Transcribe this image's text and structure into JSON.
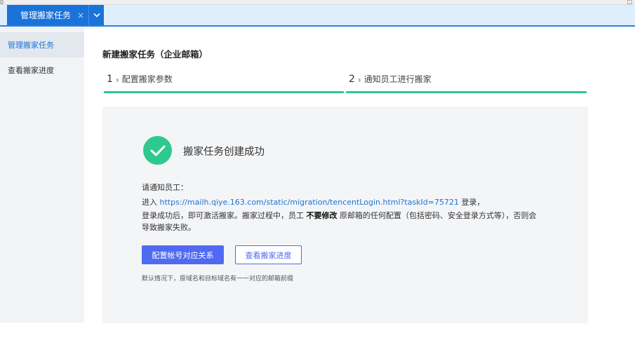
{
  "window": {
    "corner_left": "0",
    "corner_right": "□"
  },
  "tabs": [
    {
      "label": "管理搬家任务",
      "close": "×",
      "dropdown": "⌄"
    }
  ],
  "sidebar": {
    "items": [
      {
        "label": "管理搬家任务",
        "active": true
      },
      {
        "label": "查看搬家进度",
        "active": false
      }
    ]
  },
  "main": {
    "title": "新建搬家任务（企业邮箱）",
    "steps": [
      {
        "num": "1",
        "arrow": "›",
        "label": "配置搬家参数"
      },
      {
        "num": "2",
        "arrow": "›",
        "label": "通知员工进行搬家"
      }
    ],
    "result": {
      "icon": "check-circle-icon",
      "success_text": "搬家任务创建成功",
      "notify_label": "请通知员工：",
      "line1_prefix": "进入 ",
      "link": "https://mailh.qiye.163.com/static/migration/tencentLogin.html?taskId=75721",
      "line1_suffix": " 登录，",
      "line2_prefix": "登录成功后，即可激活搬家。搬家过程中，员工 ",
      "line2_bold": "不要修改",
      "line2_suffix": " 原邮箱的任何配置（包括密码、安全登录方式等），否则会",
      "line3": "导致搬家失败。",
      "primary_button": "配置帐号对应关系",
      "secondary_button": "查看搬家进度",
      "footnote": "默认情况下，原域名和目标域名有一一对应的邮箱前缀"
    }
  },
  "colors": {
    "accent": "#1a73d9",
    "success": "#2fc98f",
    "button": "#4f6af0",
    "card_bg": "#f4f5f7",
    "sidebar_bg": "#f2f3f5"
  }
}
